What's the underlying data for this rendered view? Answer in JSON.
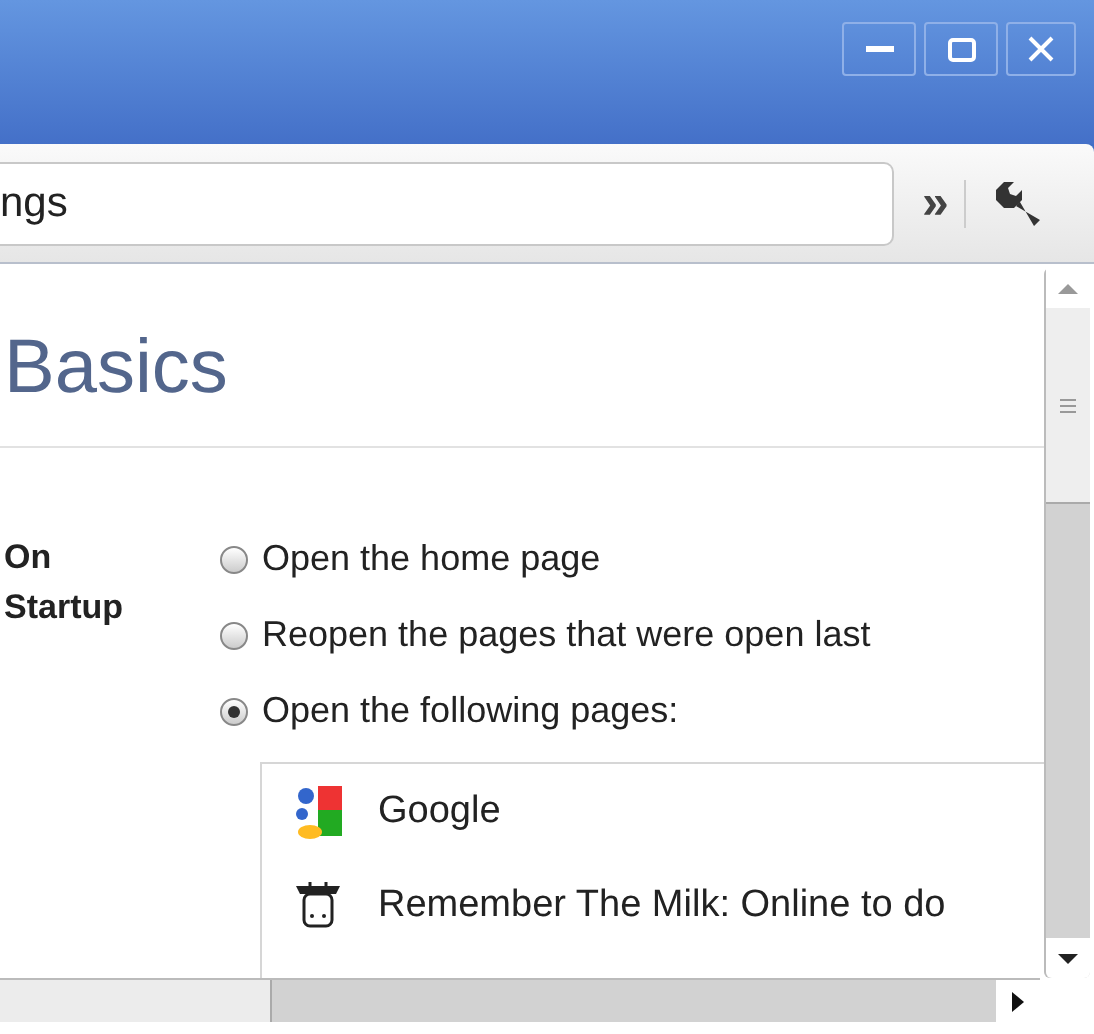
{
  "address_bar": {
    "value": "ngs"
  },
  "toolbar": {
    "overflow": "»"
  },
  "page": {
    "heading": "Basics",
    "section": {
      "label": "On Startup",
      "options": [
        {
          "label": "Open the home page",
          "selected": false
        },
        {
          "label": "Reopen the pages that were open last",
          "selected": false
        },
        {
          "label": "Open the following pages:",
          "selected": true
        }
      ],
      "pages": [
        {
          "kind": "google",
          "title": "Google"
        },
        {
          "kind": "milk",
          "title": "Remember The Milk: Online to do"
        }
      ]
    }
  }
}
